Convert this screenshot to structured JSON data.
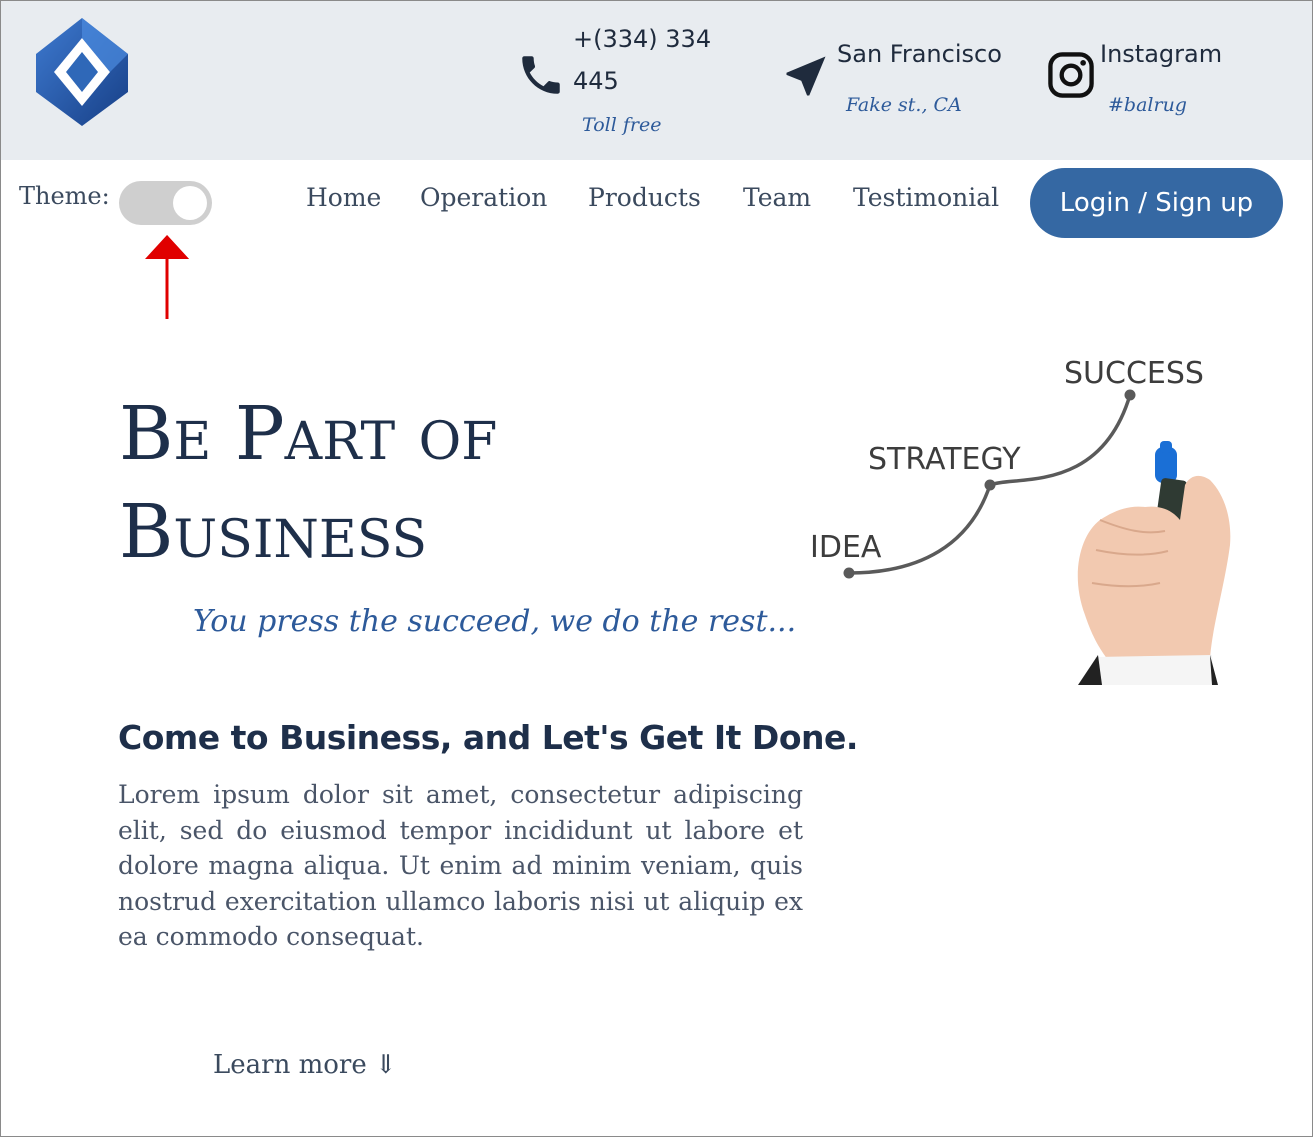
{
  "header": {
    "phone": {
      "number": "+(334) 334 445",
      "sub": "Toll free",
      "icon": "phone-icon"
    },
    "location": {
      "city": "San Francisco",
      "sub": "Fake st., CA",
      "icon": "location-arrow-icon"
    },
    "social": {
      "name": "Instagram",
      "sub": "#balrug",
      "icon": "instagram-icon"
    },
    "logo": "diamond-logo-icon"
  },
  "nav": {
    "theme_label": "Theme:",
    "items": [
      {
        "label": "Home"
      },
      {
        "label": "Operation"
      },
      {
        "label": "Products"
      },
      {
        "label": "Team"
      },
      {
        "label": "Testimonial"
      }
    ],
    "login_label": "Login / Sign up"
  },
  "hero": {
    "title_line1": "Be Part of",
    "title_line2": "Business",
    "tagline": "You press the succeed, we do the rest...",
    "subheading": "Come to Business, and Let's Get It Done.",
    "body": "Lorem ipsum dolor sit amet, consectetur adipiscing elit, sed do eiusmod tempor incididunt ut labore et dolore magna aliqua. Ut enim ad minim veniam, quis nostrud exercitation ullamco laboris nisi ut aliquip ex ea commodo consequat.",
    "learn_more": "Learn more ⇓",
    "illustration": {
      "steps": [
        "IDEA",
        "STRATEGY",
        "SUCCESS"
      ]
    }
  },
  "colors": {
    "accent": "#3568a3",
    "topbar_bg": "#e8ecf0",
    "annotation_arrow": "#e00000"
  }
}
